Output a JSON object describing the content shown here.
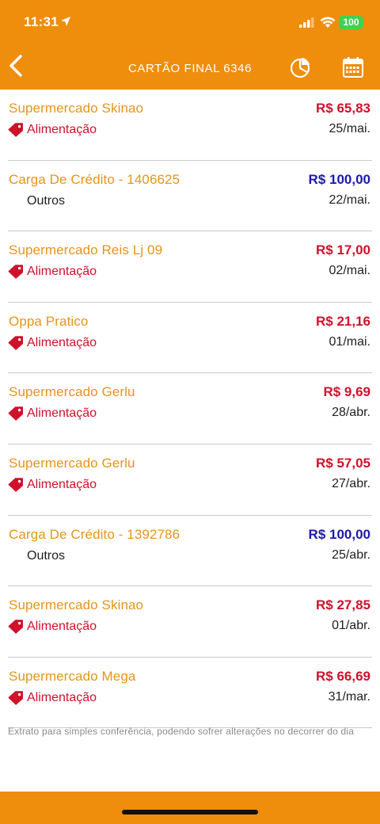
{
  "status_bar": {
    "time": "11:31",
    "battery": "100"
  },
  "header": {
    "title": "CARTÃO FINAL 6346"
  },
  "icons": {
    "back": "chevron-left-icon",
    "chart": "pie-chart-icon",
    "calendar": "calendar-icon",
    "tag": "tag-icon"
  },
  "colors": {
    "brand": "#ef8d0c",
    "merchant": "#e79418",
    "debit": "#d0112b",
    "credit": "#1d1aa8"
  },
  "transactions": [
    {
      "merchant": "Supermercado Skinao",
      "category": "Alimentação",
      "amount": "R$ 65,83",
      "date": "25/mai."
    },
    {
      "merchant": "Carga De Crédito - 1406625",
      "category": "Outros",
      "amount": "R$ 100,00",
      "date": "22/mai."
    },
    {
      "merchant": "Supermercado Reis Lj 09",
      "category": "Alimentação",
      "amount": "R$ 17,00",
      "date": "02/mai."
    },
    {
      "merchant": "Oppa Pratico",
      "category": "Alimentação",
      "amount": "R$ 21,16",
      "date": "01/mai."
    },
    {
      "merchant": "Supermercado Gerlu",
      "category": "Alimentação",
      "amount": "R$ 9,69",
      "date": "28/abr."
    },
    {
      "merchant": "Supermercado Gerlu",
      "category": "Alimentação",
      "amount": "R$ 57,05",
      "date": "27/abr."
    },
    {
      "merchant": "Carga De Crédito - 1392786",
      "category": "Outros",
      "amount": "R$ 100,00",
      "date": "25/abr."
    },
    {
      "merchant": "Supermercado Skinao",
      "category": "Alimentação",
      "amount": "R$ 27,85",
      "date": "01/abr."
    },
    {
      "merchant": "Supermercado Mega",
      "category": "Alimentação",
      "amount": "R$ 66,69",
      "date": "31/mar."
    }
  ],
  "footer": {
    "disclaimer": "Extrato para simples conferência, podendo sofrer alterações no decorrer do dia"
  }
}
